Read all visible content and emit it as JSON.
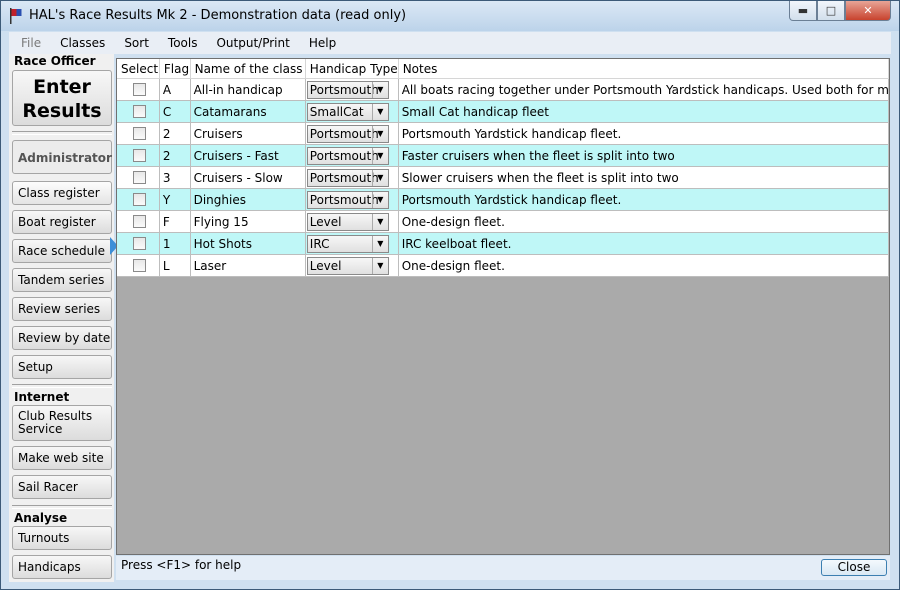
{
  "window": {
    "title": "HAL's Race Results Mk 2 - Demonstration data (read only)",
    "controls": {
      "minimize": "▬",
      "maximize": "□",
      "close": "✕"
    }
  },
  "menu": {
    "items": [
      {
        "label": "File",
        "enabled": false
      },
      {
        "label": "Classes",
        "enabled": true
      },
      {
        "label": "Sort",
        "enabled": true
      },
      {
        "label": "Tools",
        "enabled": true
      },
      {
        "label": "Output/Print",
        "enabled": true
      },
      {
        "label": "Help",
        "enabled": true
      }
    ]
  },
  "sidebar": {
    "race_officer": {
      "title": "Race Officer",
      "enter_results_line1": "Enter",
      "enter_results_line2": "Results",
      "administrator": "Administrator"
    },
    "admin_buttons": [
      "Class register",
      "Boat register",
      "Race schedule",
      "Tandem series",
      "Review series",
      "Review by date",
      "Setup"
    ],
    "internet": {
      "title": "Internet",
      "club_results_line1": "Club Results",
      "club_results_line2": "Service",
      "make_web_site": "Make web site",
      "sail_racer": "Sail Racer"
    },
    "analyse": {
      "title": "Analyse",
      "turnouts": "Turnouts",
      "handicaps": "Handicaps"
    }
  },
  "grid": {
    "headers": {
      "select": "Select",
      "flag": "Flag",
      "name": "Name of the class",
      "handicap": "Handicap Type",
      "notes": "Notes"
    },
    "rows": [
      {
        "flag": "A",
        "name": "All-in handicap",
        "handicap": "Portsmouth",
        "notes": "All boats racing together under Portsmouth Yardstick handicaps.  Used both for mass start and pursuit races."
      },
      {
        "flag": "C",
        "name": "Catamarans",
        "handicap": "SmallCat",
        "notes": "Small Cat  handicap fleet"
      },
      {
        "flag": "2",
        "name": "Cruisers",
        "handicap": "Portsmouth",
        "notes": "Portsmouth Yardstick handicap fleet."
      },
      {
        "flag": "2",
        "name": "Cruisers - Fast",
        "handicap": "Portsmouth",
        "notes": "Faster cruisers when the fleet is split into two"
      },
      {
        "flag": "3",
        "name": "Cruisers - Slow",
        "handicap": "Portsmouth",
        "notes": "Slower cruisers when the fleet is split into two"
      },
      {
        "flag": "Y",
        "name": "Dinghies",
        "handicap": "Portsmouth",
        "notes": "Portsmouth Yardstick handicap fleet."
      },
      {
        "flag": "F",
        "name": "Flying 15",
        "handicap": "Level",
        "notes": "One-design fleet."
      },
      {
        "flag": "1",
        "name": "Hot Shots",
        "handicap": "IRC",
        "notes": "IRC keelboat fleet."
      },
      {
        "flag": "L",
        "name": "Laser",
        "handicap": "Level",
        "notes": "One-design fleet."
      }
    ]
  },
  "status": {
    "help": "Press <F1> for help",
    "close_label": "Close"
  },
  "colors": {
    "alt_row": "#bff7f7",
    "active_arrow": "#3d8fd8",
    "grid_background": "#aaaaaa"
  }
}
